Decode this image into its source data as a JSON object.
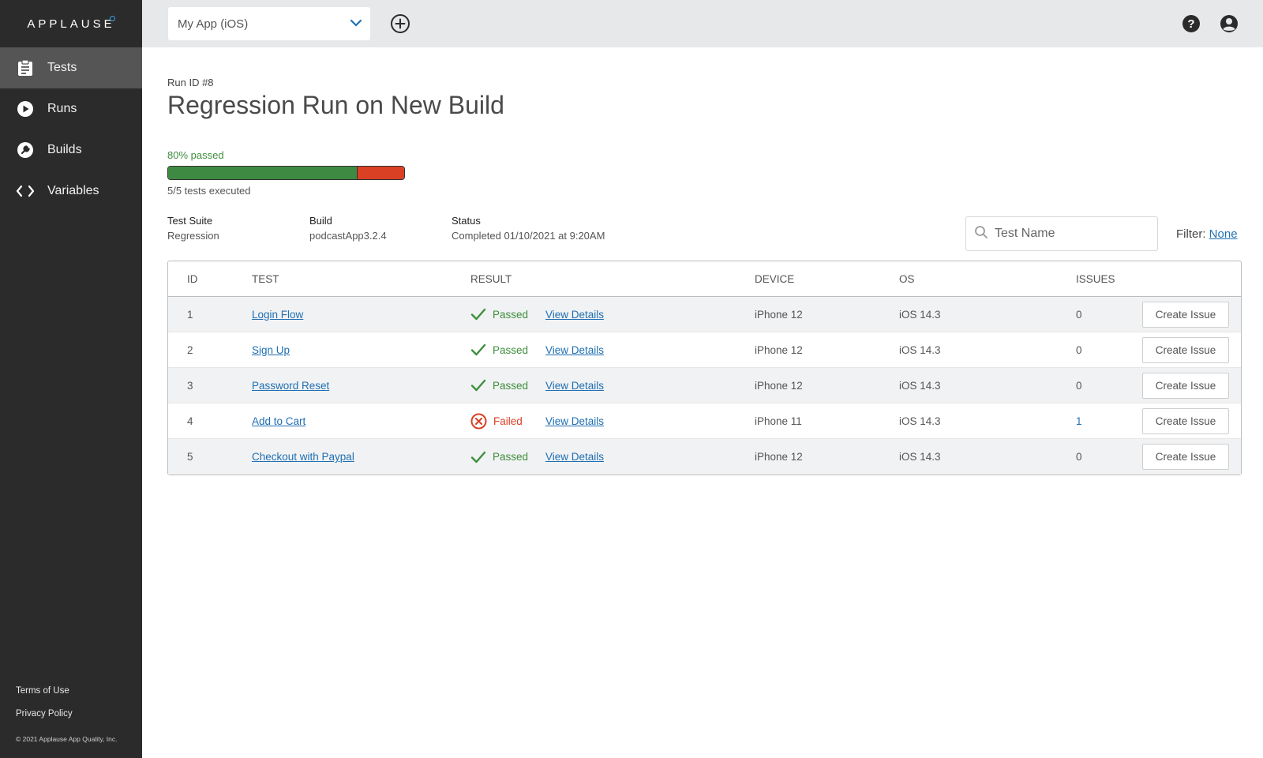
{
  "brand": {
    "logo_text": "APPLAUSE"
  },
  "sidebar": {
    "items": [
      {
        "label": "Tests",
        "icon": "clipboard-icon",
        "active": true
      },
      {
        "label": "Runs",
        "icon": "play-icon",
        "active": false
      },
      {
        "label": "Builds",
        "icon": "wrench-icon",
        "active": false
      },
      {
        "label": "Variables",
        "icon": "code-icon",
        "active": false
      }
    ],
    "footer": {
      "terms": "Terms of Use",
      "privacy": "Privacy Policy",
      "copyright": "© 2021 Applause App Quality, Inc."
    }
  },
  "topbar": {
    "app_select": "My App (iOS)",
    "icons": [
      "add-circle-icon",
      "help-icon",
      "user-icon"
    ]
  },
  "run": {
    "run_id": "Run ID #8",
    "title": "Regression Run on New Build",
    "pass_label": "80% passed",
    "pass_fraction": 0.8,
    "executed": "5/5 tests executed"
  },
  "meta": {
    "suite_label": "Test Suite",
    "suite_value": "Regression",
    "build_label": "Build",
    "build_value": "podcastApp3.2.4",
    "status_label": "Status",
    "status_value": "Completed 01/10/2021 at 9:20AM"
  },
  "search": {
    "placeholder": "Test Name"
  },
  "filter": {
    "label": "Filter:",
    "value": "None"
  },
  "table": {
    "headers": {
      "id": "ID",
      "test": "TEST",
      "result": "RESULT",
      "device": "DEVICE",
      "os": "OS",
      "issues": "ISSUES"
    },
    "rows": [
      {
        "id": "1",
        "test": "Login Flow",
        "result": "Passed",
        "details": "View Details",
        "device": "iPhone 12",
        "os": "iOS 14.3",
        "issues": "0",
        "action": "Create Issue"
      },
      {
        "id": "2",
        "test": "Sign Up",
        "result": "Passed",
        "details": "View Details",
        "device": "iPhone 12",
        "os": "iOS 14.3",
        "issues": "0",
        "action": "Create Issue"
      },
      {
        "id": "3",
        "test": "Password Reset",
        "result": "Passed",
        "details": "View Details",
        "device": "iPhone 12",
        "os": "iOS 14.3",
        "issues": "0",
        "action": "Create Issue"
      },
      {
        "id": "4",
        "test": "Add to Cart",
        "result": "Failed",
        "details": "View Details",
        "device": "iPhone 11",
        "os": "iOS 14.3",
        "issues": "1",
        "action": "Create Issue"
      },
      {
        "id": "5",
        "test": "Checkout with Paypal",
        "result": "Passed",
        "details": "View Details",
        "device": "iPhone 12",
        "os": "iOS 14.3",
        "issues": "0",
        "action": "Create Issue"
      }
    ]
  },
  "colors": {
    "sidebar": "#2b2b2b",
    "active_nav": "#555555",
    "pass": "#3f8a43",
    "fail": "#d94024",
    "link": "#1f6fb3"
  }
}
